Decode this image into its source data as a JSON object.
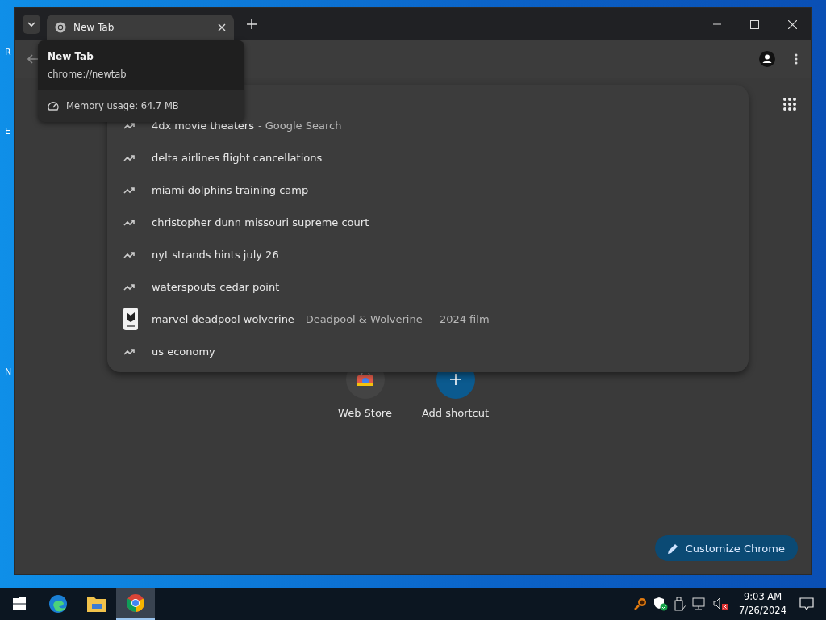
{
  "desktop": {
    "icon_labels": [
      "R",
      "E",
      "N"
    ]
  },
  "browser": {
    "tabs": [
      {
        "title": "New Tab",
        "selected": true
      }
    ],
    "tooltip": {
      "title": "New Tab",
      "url": "chrome://newtab",
      "memory": "Memory usage: 64.7 MB"
    },
    "suggestions": [
      {
        "kind": "trend",
        "text": "4dx movie theaters",
        "detail": "- Google Search"
      },
      {
        "kind": "trend",
        "text": "delta airlines flight cancellations"
      },
      {
        "kind": "trend",
        "text": "miami dolphins training camp"
      },
      {
        "kind": "trend",
        "text": "christopher dunn missouri supreme court"
      },
      {
        "kind": "trend",
        "text": "nyt strands hints july 26"
      },
      {
        "kind": "trend",
        "text": "waterspouts cedar point"
      },
      {
        "kind": "entity",
        "text": "marvel deadpool wolverine",
        "detail": "- Deadpool & Wolverine — 2024 film"
      },
      {
        "kind": "trend",
        "text": "us economy"
      }
    ],
    "shortcuts": [
      {
        "kind": "store",
        "label": "Web Store"
      },
      {
        "kind": "add",
        "label": "Add shortcut"
      }
    ],
    "customize_button": "Customize Chrome"
  },
  "taskbar": {
    "apps": [
      {
        "kind": "edge",
        "selected": false
      },
      {
        "kind": "folder",
        "selected": false
      },
      {
        "kind": "chrome",
        "selected": true
      }
    ],
    "time": "9:03 AM",
    "date": "7/26/2024"
  }
}
